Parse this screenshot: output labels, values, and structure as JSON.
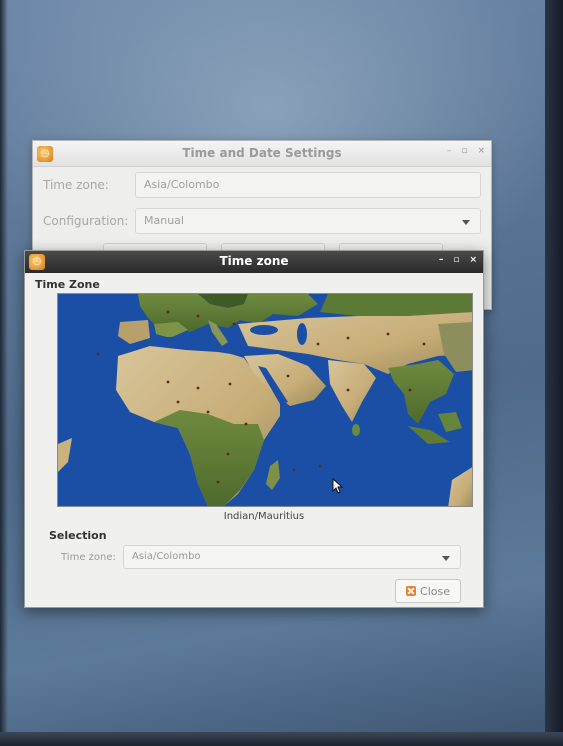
{
  "back_window": {
    "title": "Time and Date Settings",
    "controls": {
      "minimize": "–",
      "maximize": "▫",
      "close": "×"
    },
    "timezone_label": "Time zone:",
    "timezone_value": "Asia/Colombo",
    "configuration_label": "Configuration:",
    "configuration_value": "Manual"
  },
  "front_window": {
    "title": "Time zone",
    "controls": {
      "minimize": "–",
      "maximize": "▫",
      "close": "×"
    },
    "heading": "Time Zone",
    "hovered_zone": "Indian/Mauritius",
    "selection_heading": "Selection",
    "timezone_label": "Time zone:",
    "timezone_value": "Asia/Colombo",
    "close_label": "Close"
  },
  "icons": {
    "app": "clock-icon",
    "close_button": "close-icon",
    "cursor": "mouse-pointer-icon"
  },
  "colors": {
    "ocean": "#1b4fa5",
    "land_desert": "#cdb88a",
    "land_green": "#5d7b36",
    "titlebar_dark": "#2a2a2a",
    "accent": "#e9802a"
  }
}
